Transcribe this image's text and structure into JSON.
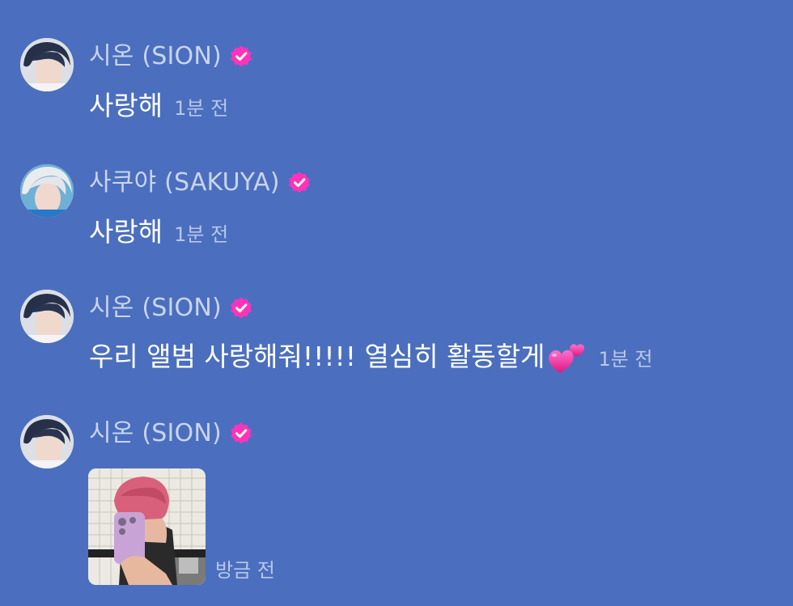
{
  "messages": [
    {
      "author": "시온 (SION)",
      "text": "사랑해",
      "time": "1분 전",
      "verified_icon": "verified-badge-icon",
      "avatar_icon": "avatar-sion"
    },
    {
      "author": "사쿠야 (SAKUYA)",
      "text": "사랑해",
      "time": "1분 전",
      "verified_icon": "verified-badge-icon",
      "avatar_icon": "avatar-sakuya"
    },
    {
      "author": "시온 (SION)",
      "text": "우리 앨범 사랑해줘!!!!! 열심히 활동할게",
      "emoji": "two-hearts-icon",
      "time": "1분 전",
      "verified_icon": "verified-badge-icon",
      "avatar_icon": "avatar-sion"
    },
    {
      "author": "시온 (SION)",
      "attachment": "photo",
      "time": "방금 전",
      "verified_icon": "verified-badge-icon",
      "avatar_icon": "avatar-sion"
    }
  ],
  "colors": {
    "background": "#4B6FBE",
    "name": "#C9D4EF",
    "time": "#B9C6E9",
    "badge": "#FF33BB",
    "message_text": "#FFFFFF"
  }
}
